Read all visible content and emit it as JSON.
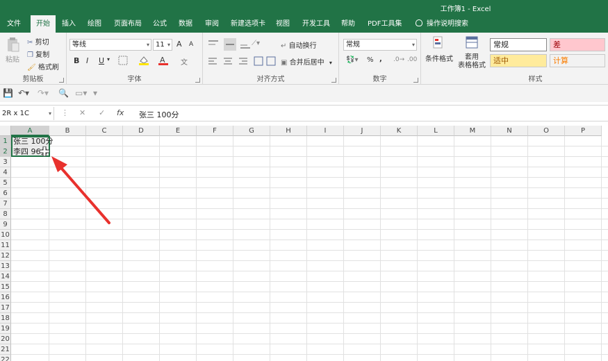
{
  "window": {
    "title": "工作簿1  -  Excel"
  },
  "tabs": [
    {
      "label": "文件"
    },
    {
      "label": "开始"
    },
    {
      "label": "插入"
    },
    {
      "label": "绘图"
    },
    {
      "label": "页面布局"
    },
    {
      "label": "公式"
    },
    {
      "label": "数据"
    },
    {
      "label": "审阅"
    },
    {
      "label": "新建选项卡"
    },
    {
      "label": "视图"
    },
    {
      "label": "开发工具"
    },
    {
      "label": "帮助"
    },
    {
      "label": "PDF工具集"
    }
  ],
  "tell_me": "操作说明搜索",
  "clipboard": {
    "paste": "粘贴",
    "cut": "剪切",
    "copy": "复制",
    "format_painter": "格式刷",
    "label": "剪贴板"
  },
  "font": {
    "name": "等线",
    "size": "11",
    "label": "字体",
    "bold": "B",
    "italic": "I",
    "underline": "U",
    "grow": "A",
    "shrink": "A"
  },
  "alignment": {
    "wrap": "自动换行",
    "merge": "合并后居中",
    "label": "对齐方式"
  },
  "number": {
    "format": "常规",
    "percent": "%",
    "comma": ",",
    "label": "数字"
  },
  "styles": {
    "conditional": "条件格式",
    "table1": "套用",
    "table2": "表格格式",
    "normal": "常规",
    "bad": "差",
    "neutral": "适中",
    "calc": "计算",
    "label": "样式"
  },
  "formula_bar": {
    "name_box": "2R x 1C",
    "cancel": "✕",
    "enter": "✓",
    "fx": "fx",
    "content": "张三  100分"
  },
  "columns": [
    "A",
    "B",
    "C",
    "D",
    "E",
    "F",
    "G",
    "H",
    "I",
    "J",
    "K",
    "L",
    "M",
    "N",
    "O",
    "P"
  ],
  "rows": [
    "1",
    "2",
    "3",
    "4",
    "5",
    "6",
    "7",
    "8",
    "9",
    "10",
    "11",
    "12",
    "13",
    "14",
    "15",
    "16",
    "17",
    "18",
    "19",
    "20",
    "21",
    "22"
  ],
  "cells": {
    "A1": "张三  100分",
    "A2": "李四  96分"
  },
  "colors": {
    "brand": "#217346",
    "arrow": "#e8312d",
    "bad_bg": "#ffc7ce",
    "bad_fg": "#9c0006",
    "neutral_bg": "#ffeb9c",
    "neutral_fg": "#9c5700",
    "calc_bg": "#f2f2f2",
    "calc_fg": "#fa7d00"
  }
}
